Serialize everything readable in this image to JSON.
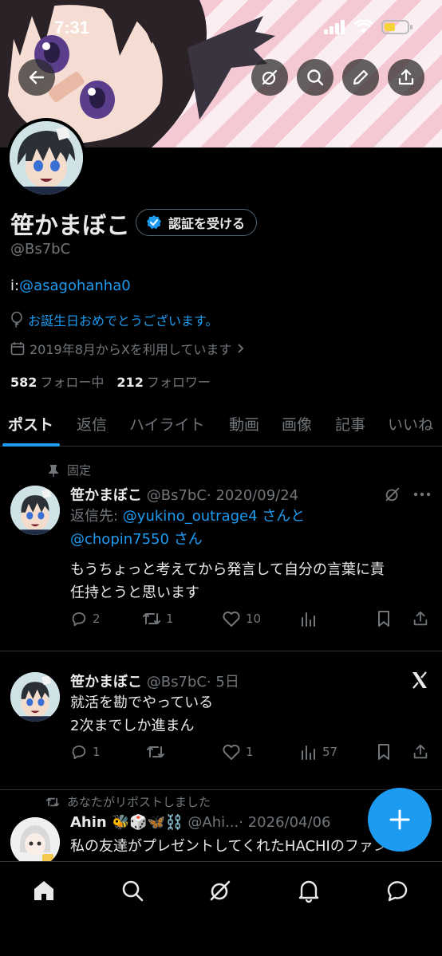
{
  "status": {
    "time": "7:31"
  },
  "profile": {
    "name": "笹かまぼこ",
    "verify_label": "認証を受ける",
    "handle": "@Bs7bC",
    "bio_prefix": "i:",
    "bio_link": "@asagohanha0",
    "birthday": "お誕生日おめでとうございます。",
    "joined": "2019年8月からXを利用しています",
    "following_count": "582",
    "following_label": "フォロー中",
    "followers_count": "212",
    "followers_label": "フォロワー"
  },
  "tabs": [
    "ポスト",
    "返信",
    "ハイライト",
    "動画",
    "画像",
    "記事",
    "いいね"
  ],
  "posts": [
    {
      "pinned_label": "固定",
      "name": "笹かまぼこ",
      "handle": "@Bs7bC",
      "date": "· 2020/09/24",
      "reply_prefix": "返信先: ",
      "reply_user1": "@yukino_outrage4",
      "reply_mid": " さんと",
      "reply_user2": "@chopin7550",
      "reply_suffix": " さん",
      "text_line1": "もうちょっと考えてから発言して自分の言葉に責",
      "text_line2": "任持とうと思います",
      "replies": "2",
      "reposts": "1",
      "likes": "10",
      "views": ""
    },
    {
      "name": "笹かまぼこ",
      "handle": "@Bs7bC",
      "date": "· 5日",
      "text_line1": "就活を勘でやっている",
      "text_line2": "2次までしか進まん",
      "replies": "1",
      "reposts": "",
      "likes": "1",
      "views": "57"
    },
    {
      "repost_label": "あなたがリポストしました",
      "name": "Ahin 🐝🎲🦋⛓️",
      "handle": "@Ahi...",
      "date": "· 2026/04/06",
      "text_line1": "私の友達がプレゼントしてくれたHACHIのファン"
    }
  ],
  "colors": {
    "accent": "#1d9bf0",
    "muted": "#71767b",
    "text": "#e7e9ea",
    "border": "#2f3336"
  }
}
